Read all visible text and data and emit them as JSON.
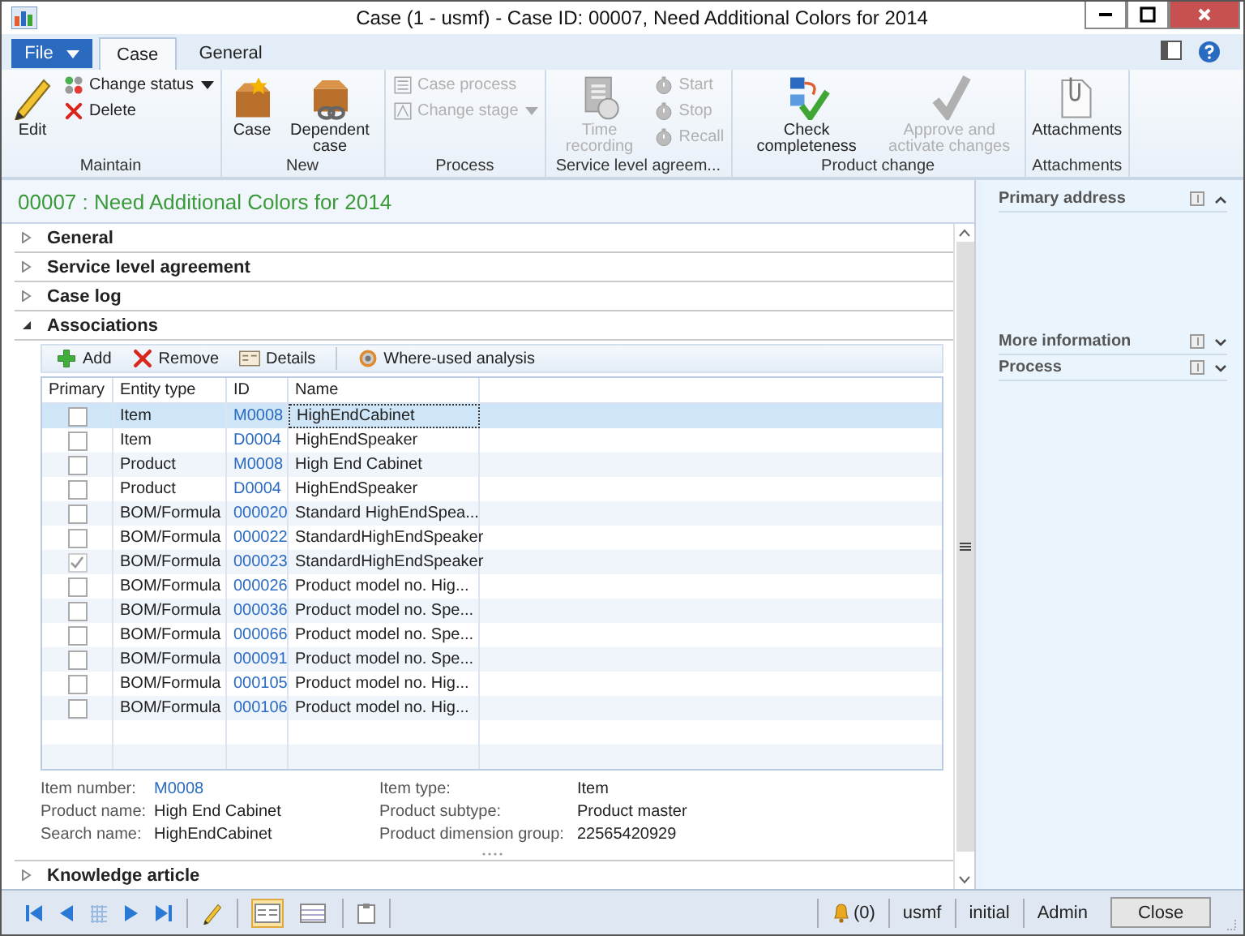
{
  "window": {
    "title": "Case (1 - usmf) - Case ID: 00007, Need Additional Colors for 2014"
  },
  "file_menu": {
    "label": "File"
  },
  "tabs": [
    {
      "label": "Case",
      "selected": true
    },
    {
      "label": "General",
      "selected": false
    }
  ],
  "ribbon": [
    {
      "label": "Maintain",
      "buttons": [
        {
          "label": "Edit",
          "kind": "large",
          "disabled": false
        },
        {
          "label": "Change status",
          "kind": "small",
          "disabled": false,
          "dropdown": true
        },
        {
          "label": "Delete",
          "kind": "small",
          "disabled": false,
          "dropdown": false
        }
      ]
    },
    {
      "label": "New",
      "buttons": [
        {
          "label": "Case",
          "kind": "large",
          "disabled": false
        },
        {
          "label": "Dependent case",
          "kind": "large",
          "disabled": false
        }
      ]
    },
    {
      "label": "Process",
      "buttons": [
        {
          "label": "Case process",
          "kind": "small",
          "disabled": true,
          "dropdown": false
        },
        {
          "label": "Change stage",
          "kind": "small",
          "disabled": true,
          "dropdown": true
        }
      ]
    },
    {
      "label": "Service level agreem...",
      "buttons": [
        {
          "label": "Time recording",
          "kind": "large",
          "disabled": true
        },
        {
          "label": "Start",
          "kind": "small",
          "disabled": true,
          "dropdown": false
        },
        {
          "label": "Stop",
          "kind": "small",
          "disabled": true,
          "dropdown": false
        },
        {
          "label": "Recall",
          "kind": "small",
          "disabled": true,
          "dropdown": false
        }
      ]
    },
    {
      "label": "Product change",
      "buttons": [
        {
          "label": "Check completeness",
          "kind": "large",
          "disabled": false
        },
        {
          "label": "Approve and activate changes",
          "kind": "large",
          "disabled": true
        }
      ]
    },
    {
      "label": "Attachments",
      "buttons": [
        {
          "label": "Attachments",
          "kind": "large",
          "disabled": false
        }
      ]
    }
  ],
  "page_title": "00007 : Need Additional Colors for 2014",
  "sections": [
    {
      "label": "General",
      "expanded": false
    },
    {
      "label": "Service level agreement",
      "expanded": false
    },
    {
      "label": "Case log",
      "expanded": false
    },
    {
      "label": "Associations",
      "expanded": true
    }
  ],
  "associations": {
    "toolbar": [
      "Add",
      "Remove",
      "Details",
      "Where-used analysis"
    ],
    "columns": [
      "Primary",
      "Entity type",
      "ID",
      "Name"
    ],
    "rows": [
      {
        "primary": false,
        "entity_type": "Item",
        "id": "M0008",
        "name": "HighEndCabinet",
        "selected": true
      },
      {
        "primary": false,
        "entity_type": "Item",
        "id": "D0004",
        "name": "HighEndSpeaker",
        "selected": false
      },
      {
        "primary": false,
        "entity_type": "Product",
        "id": "M0008",
        "name": "High End Cabinet",
        "selected": false
      },
      {
        "primary": false,
        "entity_type": "Product",
        "id": "D0004",
        "name": "HighEndSpeaker",
        "selected": false
      },
      {
        "primary": false,
        "entity_type": "BOM/Formula",
        "id": "000020",
        "name": "Standard HighEndSpea...",
        "selected": false
      },
      {
        "primary": false,
        "entity_type": "BOM/Formula",
        "id": "000022",
        "name": "StandardHighEndSpeaker",
        "selected": false
      },
      {
        "primary": true,
        "entity_type": "BOM/Formula",
        "id": "000023",
        "name": "StandardHighEndSpeaker",
        "selected": false
      },
      {
        "primary": false,
        "entity_type": "BOM/Formula",
        "id": "000026",
        "name": "Product model no. Hig...",
        "selected": false
      },
      {
        "primary": false,
        "entity_type": "BOM/Formula",
        "id": "000036",
        "name": "Product model no. Spe...",
        "selected": false
      },
      {
        "primary": false,
        "entity_type": "BOM/Formula",
        "id": "000066",
        "name": "Product model no. Spe...",
        "selected": false
      },
      {
        "primary": false,
        "entity_type": "BOM/Formula",
        "id": "000091",
        "name": "Product model no. Spe...",
        "selected": false
      },
      {
        "primary": false,
        "entity_type": "BOM/Formula",
        "id": "000105",
        "name": "Product model no. Hig...",
        "selected": false
      },
      {
        "primary": false,
        "entity_type": "BOM/Formula",
        "id": "000106",
        "name": "Product model no. Hig...",
        "selected": false
      }
    ],
    "details_left": [
      {
        "label": "Item number:",
        "value": "M0008",
        "link": true
      },
      {
        "label": "Product name:",
        "value": "High End Cabinet",
        "link": false
      },
      {
        "label": "Search name:",
        "value": "HighEndCabinet",
        "link": false
      }
    ],
    "details_right": [
      {
        "label": "Item type:",
        "value": "Item",
        "link": false
      },
      {
        "label": "Product subtype:",
        "value": "Product master",
        "link": false
      },
      {
        "label": "Product dimension group:",
        "value": "22565420929",
        "link": false
      }
    ]
  },
  "last_section": {
    "label": "Knowledge article",
    "expanded": false
  },
  "factboxes": [
    {
      "label": "Primary address",
      "expanded": true
    },
    {
      "label": "More information",
      "expanded": false
    },
    {
      "label": "Process",
      "expanded": false
    }
  ],
  "status_bar": {
    "view_buttons": [
      {
        "selected": true
      },
      {
        "selected": false
      }
    ],
    "notifications": "(0)",
    "fields": [
      "usmf",
      "initial",
      "Admin"
    ],
    "close_button": "Close"
  }
}
